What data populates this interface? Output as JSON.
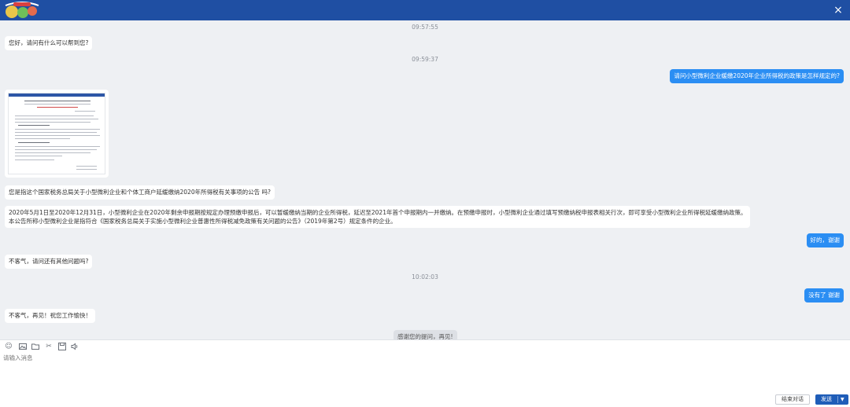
{
  "header": {
    "close_label": "×"
  },
  "messages": {
    "ts1": "09:57:55",
    "m1": "您好，请问有什么可以帮到您?",
    "ts2": "09:59:37",
    "m2": "请问小型微利企业缓缴2020年企业所得税的政策是怎样规定的?",
    "m3": "您是指这个国家税务总局关于小型微利企业和个体工商户延缓缴纳2020年所得税有关事项的公告 吗?",
    "m4_line1": "2020年5月1日至2020年12月31日，小型微利企业在2020年剩余申报期按规定办理预缴申报后，可以暂缓缴纳当期的企业所得税，延迟至2021年首个申报期内一并缴纳。在预缴申报时，小型微利企业通过填写预缴纳税申报表相关行次，即可享受小型微利企业所得税延缓缴纳政策。",
    "m4_line2": "本公告所称小型微利企业是指符合《国家税务总局关于实施小型微利企业普惠性所得税减免政策有关问题的公告》（2019年第2号）规定条件的企业。",
    "m5": "好的，谢谢",
    "m6": "不客气，请问还有其他问题吗?",
    "ts3": "10:02:03",
    "m7": "没有了 谢谢",
    "m8": "不客气，再见！祝您工作愉快！",
    "m9": "感谢您的提问，再见!"
  },
  "toolbar": {
    "icons": [
      "emoji-icon",
      "image-icon",
      "folder-icon",
      "scissors-icon",
      "save-icon",
      "voice-icon"
    ]
  },
  "input": {
    "placeholder": "请输入消息"
  },
  "buttons": {
    "end_label": "结束对话",
    "send_label": "发送",
    "send_caret": "▼"
  }
}
